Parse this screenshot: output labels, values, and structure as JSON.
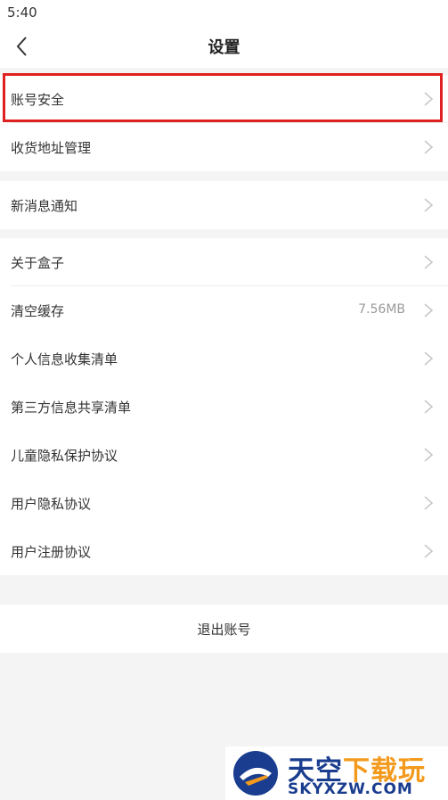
{
  "status_bar": {
    "time": "5:40"
  },
  "header": {
    "title": "设置"
  },
  "groups": [
    {
      "items": [
        {
          "label": "账号安全"
        },
        {
          "label": "收货地址管理"
        }
      ]
    },
    {
      "items": [
        {
          "label": "新消息通知"
        }
      ]
    },
    {
      "items": [
        {
          "label": "关于盒子"
        },
        {
          "label": "清空缓存",
          "value": "7.56MB"
        },
        {
          "label": "个人信息收集清单"
        },
        {
          "label": "第三方信息共享清单"
        },
        {
          "label": "儿童隐私保护协议"
        },
        {
          "label": "用户隐私协议"
        },
        {
          "label": "用户注册协议"
        }
      ]
    }
  ],
  "logout": {
    "label": "退出账号"
  },
  "watermark": {
    "brand_main": "天空",
    "brand_accent": "下载玩",
    "url": "SKYXZW.COM"
  },
  "colors": {
    "highlight": "#e02020",
    "chevron": "#c8c8c8",
    "brand_blue": "#1a3d8f",
    "brand_orange": "#f39a1c"
  }
}
